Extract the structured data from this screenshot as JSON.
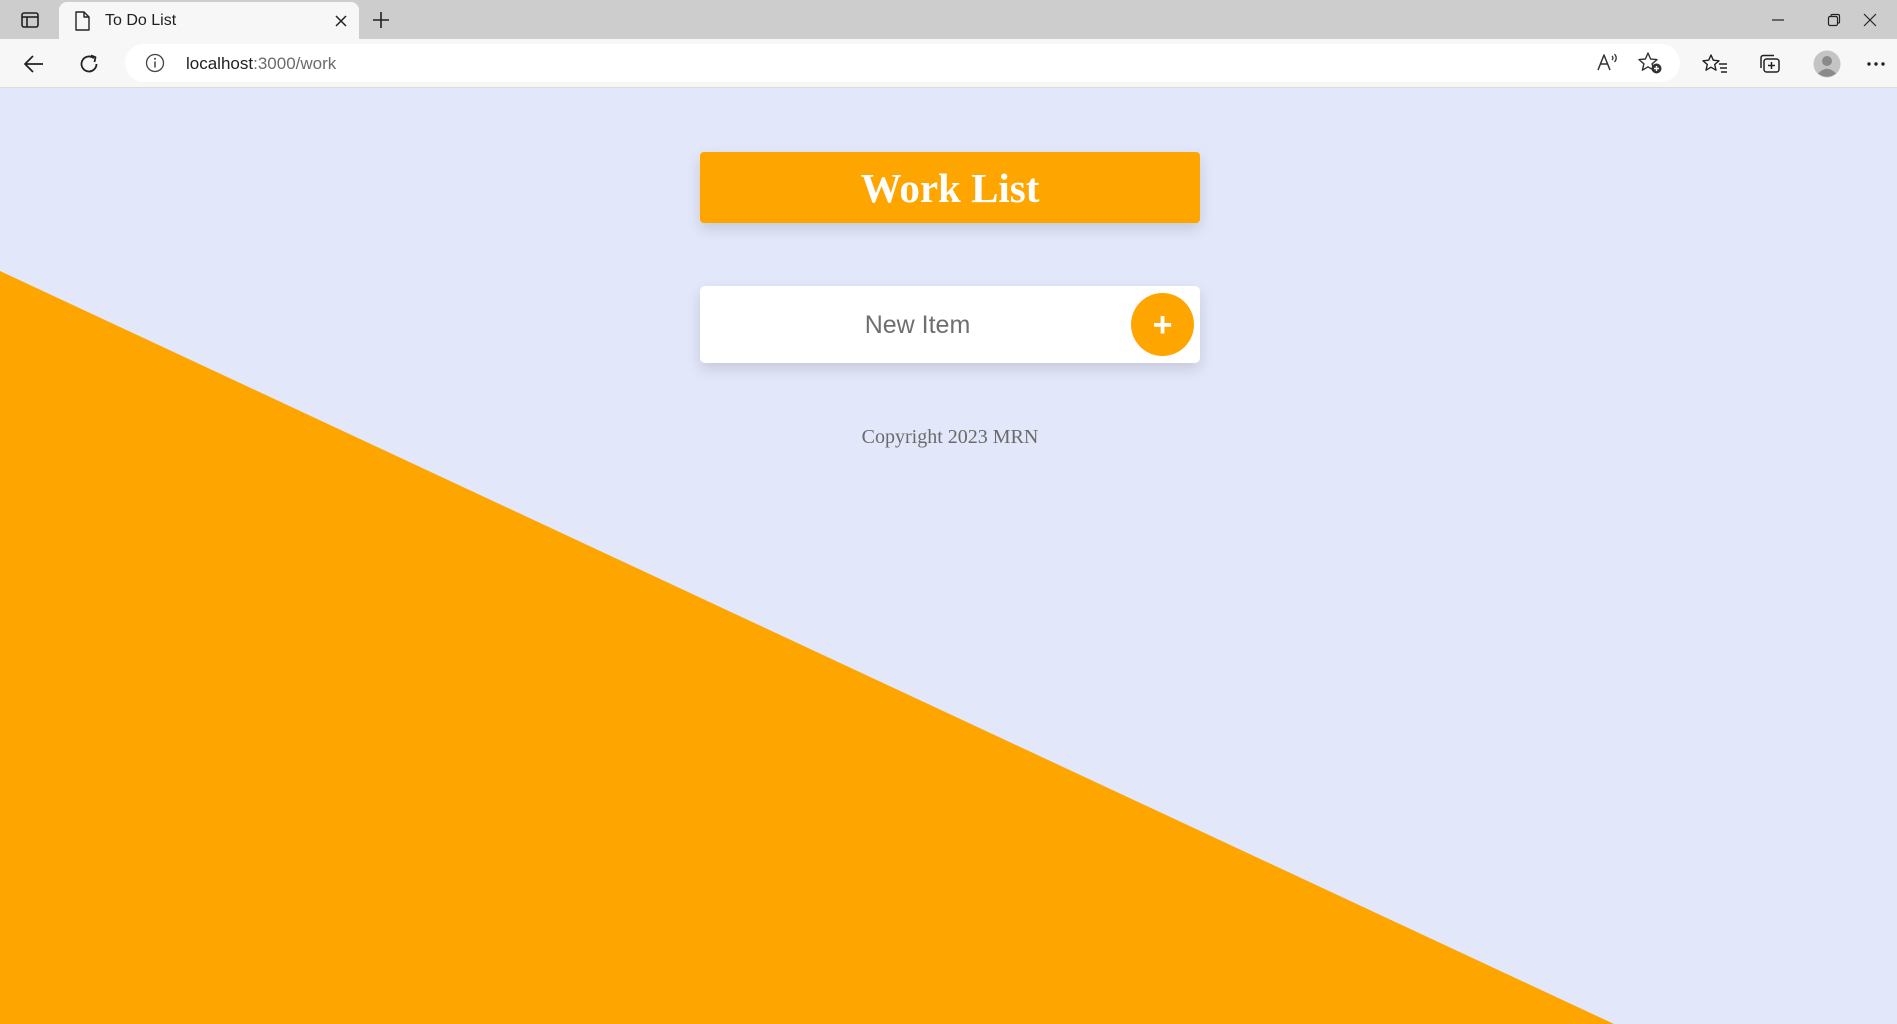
{
  "browser": {
    "tab": {
      "title": "To Do List"
    },
    "address": {
      "host": "localhost",
      "path": ":3000/work"
    },
    "icons": {
      "tab_actions": "tab-actions-icon",
      "document": "document-icon",
      "close": "close-icon",
      "new_tab": "plus-icon",
      "back": "back-arrow-icon",
      "reload": "reload-icon",
      "info": "info-icon",
      "read_aloud": "read-aloud-icon",
      "add_favorite": "add-favorite-icon",
      "favorites": "favorites-icon",
      "collections": "collections-icon",
      "profile": "profile-avatar",
      "more": "more-icon"
    }
  },
  "page": {
    "heading": "Work List",
    "new_item": {
      "placeholder": "New Item",
      "add_label": "+"
    },
    "footer": "Copyright 2023 MRN"
  },
  "colors": {
    "background": "#e2e7fa",
    "accent": "#ffa500",
    "card": "#ffffff"
  }
}
